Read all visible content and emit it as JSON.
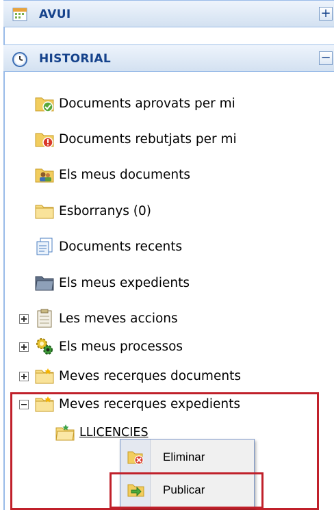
{
  "accordion": {
    "today": {
      "title": "AVUI",
      "toggle": "+"
    },
    "history": {
      "title": "HISTORIAL",
      "toggle": "−"
    }
  },
  "tree": {
    "items": [
      {
        "label": "Documents aprovats per mi",
        "icon": "folder-approved-icon"
      },
      {
        "label": "Documents rebutjats per mi",
        "icon": "folder-rejected-icon"
      },
      {
        "label": "Els meus documents",
        "icon": "folder-user-icon"
      },
      {
        "label": "Esborranys (0)",
        "icon": "folder-icon"
      },
      {
        "label": "Documents recents",
        "icon": "recent-documents-icon"
      },
      {
        "label": "Els meus expedients",
        "icon": "folder-dark-icon"
      },
      {
        "label": "Les meves accions",
        "icon": "clipboard-icon"
      },
      {
        "label": "Els meus processos",
        "icon": "gears-icon"
      },
      {
        "label": "Meves recerques documents",
        "icon": "folder-search-icon"
      },
      {
        "label": "Meves recerques expedients",
        "icon": "folder-search-icon"
      }
    ],
    "child": {
      "label": "LLICENCIES",
      "icon": "saved-search-folder-icon"
    }
  },
  "context_menu": {
    "items": [
      {
        "label": "Eliminar",
        "icon": "delete-folder-icon"
      },
      {
        "label": "Publicar",
        "icon": "publish-icon"
      }
    ]
  },
  "colors": {
    "header_text": "#15428b",
    "border": "#99bbe8",
    "highlight": "#c0202a"
  }
}
